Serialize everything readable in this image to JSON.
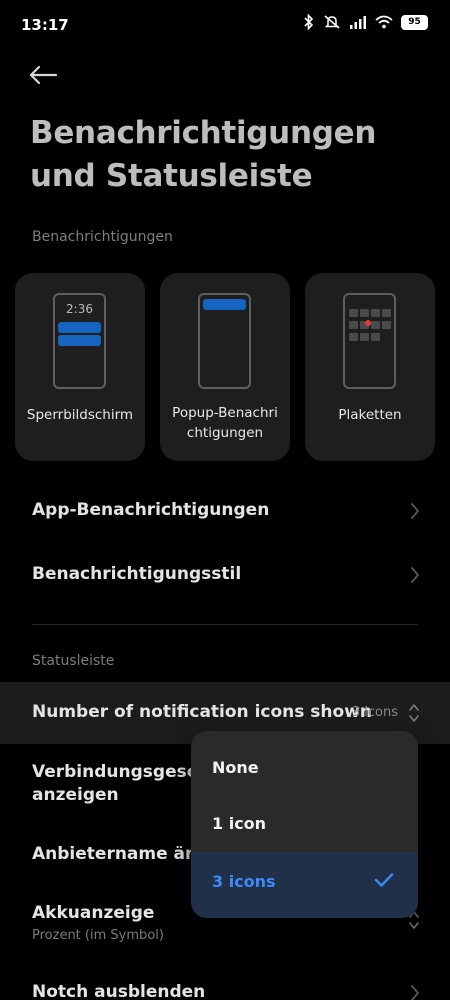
{
  "status_bar": {
    "time": "13:17",
    "battery": "95"
  },
  "page": {
    "title_line1": "Benachrichtigungen",
    "title_line2": "und Statusleiste"
  },
  "notifications_section": {
    "label": "Benachrichtigungen",
    "cards": [
      {
        "label": "Sperrbildschirm",
        "clock": "2:36"
      },
      {
        "label_line1": "Popup-Benachri",
        "label_line2": "chtigungen"
      },
      {
        "label": "Plaketten"
      }
    ],
    "items": [
      {
        "title": "App-Benachrichtigungen"
      },
      {
        "title": "Benachrichtigungsstil"
      }
    ]
  },
  "statusbar_section": {
    "label": "Statusleiste",
    "icons_row": {
      "title": "Number of notification icons shown",
      "value": "3 icons"
    },
    "connection_row": {
      "title_line1": "Verbindungsgesch",
      "title_line2": "anzeigen"
    },
    "carrier_row": {
      "title": "Anbietername ände"
    },
    "battery_row": {
      "title": "Akkuanzeige",
      "subtitle": "Prozent (im Symbol)"
    },
    "notch_row": {
      "title": "Notch ausblenden"
    }
  },
  "dropdown": {
    "options": [
      {
        "label": "None",
        "selected": false
      },
      {
        "label": "1 icon",
        "selected": false
      },
      {
        "label": "3 icons",
        "selected": true
      }
    ]
  },
  "colors": {
    "accent": "#3d8af7",
    "selected_bg": "#1f3048",
    "illustration_blue": "#1565c0",
    "badge_red": "#e53935"
  }
}
